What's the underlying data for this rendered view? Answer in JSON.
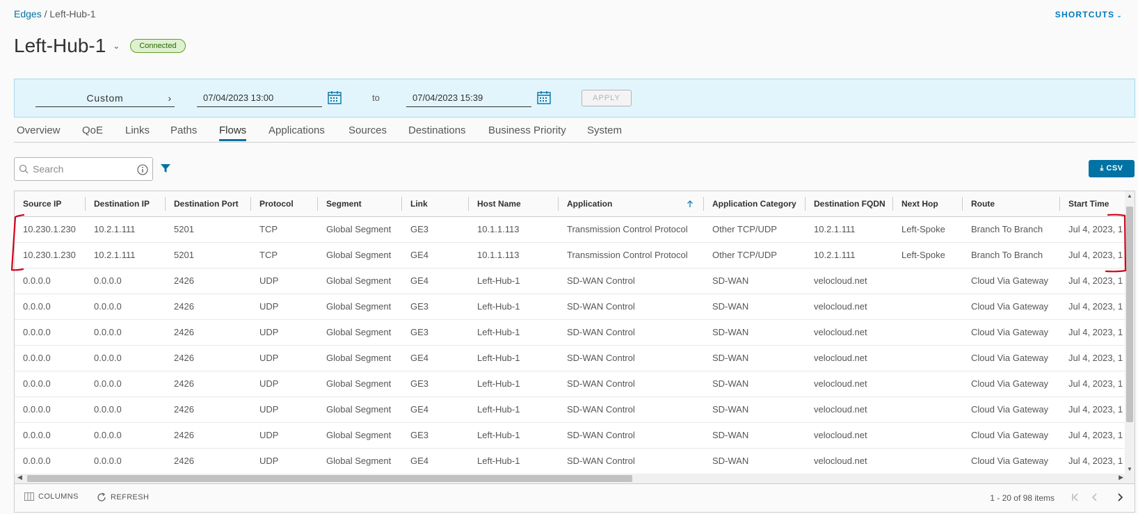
{
  "breadcrumb": {
    "parent": "Edges",
    "separator": " / ",
    "current": "Left-Hub-1"
  },
  "shortcuts": {
    "label": "SHORTCUTS"
  },
  "header": {
    "title": "Left-Hub-1",
    "status": "Connected"
  },
  "date_filter": {
    "range": "Custom",
    "from": "07/04/2023 13:00",
    "to_label": "to",
    "to": "07/04/2023 15:39",
    "apply_label": "APPLY"
  },
  "tabs": [
    {
      "label": "Overview"
    },
    {
      "label": "QoE"
    },
    {
      "label": "Links"
    },
    {
      "label": "Paths"
    },
    {
      "label": "Flows",
      "active": true
    },
    {
      "label": "Applications"
    },
    {
      "label": "Sources"
    },
    {
      "label": "Destinations"
    },
    {
      "label": "Business Priority"
    },
    {
      "label": "System"
    }
  ],
  "search": {
    "placeholder": "Search",
    "value": ""
  },
  "csv_button": {
    "label": "CSV"
  },
  "table": {
    "columns": [
      "Source IP",
      "Destination IP",
      "Destination Port",
      "Protocol",
      "Segment",
      "Link",
      "Host Name",
      "Application",
      "Application Category",
      "Destination FQDN",
      "Next Hop",
      "Route",
      "Start Time"
    ],
    "sorted_column": "Application",
    "rows": [
      [
        "10.230.1.230",
        "10.2.1.111",
        "5201",
        "TCP",
        "Global Segment",
        "GE3",
        "10.1.1.113",
        "Transmission Control Protocol",
        "Other TCP/UDP",
        "10.2.1.111",
        "Left-Spoke",
        "Branch To Branch",
        "Jul 4, 2023, 1"
      ],
      [
        "10.230.1.230",
        "10.2.1.111",
        "5201",
        "TCP",
        "Global Segment",
        "GE4",
        "10.1.1.113",
        "Transmission Control Protocol",
        "Other TCP/UDP",
        "10.2.1.111",
        "Left-Spoke",
        "Branch To Branch",
        "Jul 4, 2023, 1"
      ],
      [
        "0.0.0.0",
        "0.0.0.0",
        "2426",
        "UDP",
        "Global Segment",
        "GE4",
        "Left-Hub-1",
        "SD-WAN Control",
        "SD-WAN",
        "velocloud.net",
        "",
        "Cloud Via Gateway",
        "Jul 4, 2023, 1"
      ],
      [
        "0.0.0.0",
        "0.0.0.0",
        "2426",
        "UDP",
        "Global Segment",
        "GE3",
        "Left-Hub-1",
        "SD-WAN Control",
        "SD-WAN",
        "velocloud.net",
        "",
        "Cloud Via Gateway",
        "Jul 4, 2023, 1"
      ],
      [
        "0.0.0.0",
        "0.0.0.0",
        "2426",
        "UDP",
        "Global Segment",
        "GE3",
        "Left-Hub-1",
        "SD-WAN Control",
        "SD-WAN",
        "velocloud.net",
        "",
        "Cloud Via Gateway",
        "Jul 4, 2023, 1"
      ],
      [
        "0.0.0.0",
        "0.0.0.0",
        "2426",
        "UDP",
        "Global Segment",
        "GE4",
        "Left-Hub-1",
        "SD-WAN Control",
        "SD-WAN",
        "velocloud.net",
        "",
        "Cloud Via Gateway",
        "Jul 4, 2023, 1"
      ],
      [
        "0.0.0.0",
        "0.0.0.0",
        "2426",
        "UDP",
        "Global Segment",
        "GE3",
        "Left-Hub-1",
        "SD-WAN Control",
        "SD-WAN",
        "velocloud.net",
        "",
        "Cloud Via Gateway",
        "Jul 4, 2023, 1"
      ],
      [
        "0.0.0.0",
        "0.0.0.0",
        "2426",
        "UDP",
        "Global Segment",
        "GE4",
        "Left-Hub-1",
        "SD-WAN Control",
        "SD-WAN",
        "velocloud.net",
        "",
        "Cloud Via Gateway",
        "Jul 4, 2023, 1"
      ],
      [
        "0.0.0.0",
        "0.0.0.0",
        "2426",
        "UDP",
        "Global Segment",
        "GE3",
        "Left-Hub-1",
        "SD-WAN Control",
        "SD-WAN",
        "velocloud.net",
        "",
        "Cloud Via Gateway",
        "Jul 4, 2023, 1"
      ],
      [
        "0.0.0.0",
        "0.0.0.0",
        "2426",
        "UDP",
        "Global Segment",
        "GE4",
        "Left-Hub-1",
        "SD-WAN Control",
        "SD-WAN",
        "velocloud.net",
        "",
        "Cloud Via Gateway",
        "Jul 4, 2023, 1"
      ]
    ]
  },
  "footer": {
    "columns_label": "COLUMNS",
    "refresh_label": "REFRESH",
    "pagination": "1 - 20 of 98 items"
  },
  "colors": {
    "accent": "#0072a3",
    "annotation": "#d0021b",
    "status_bg": "#dff0d0"
  }
}
